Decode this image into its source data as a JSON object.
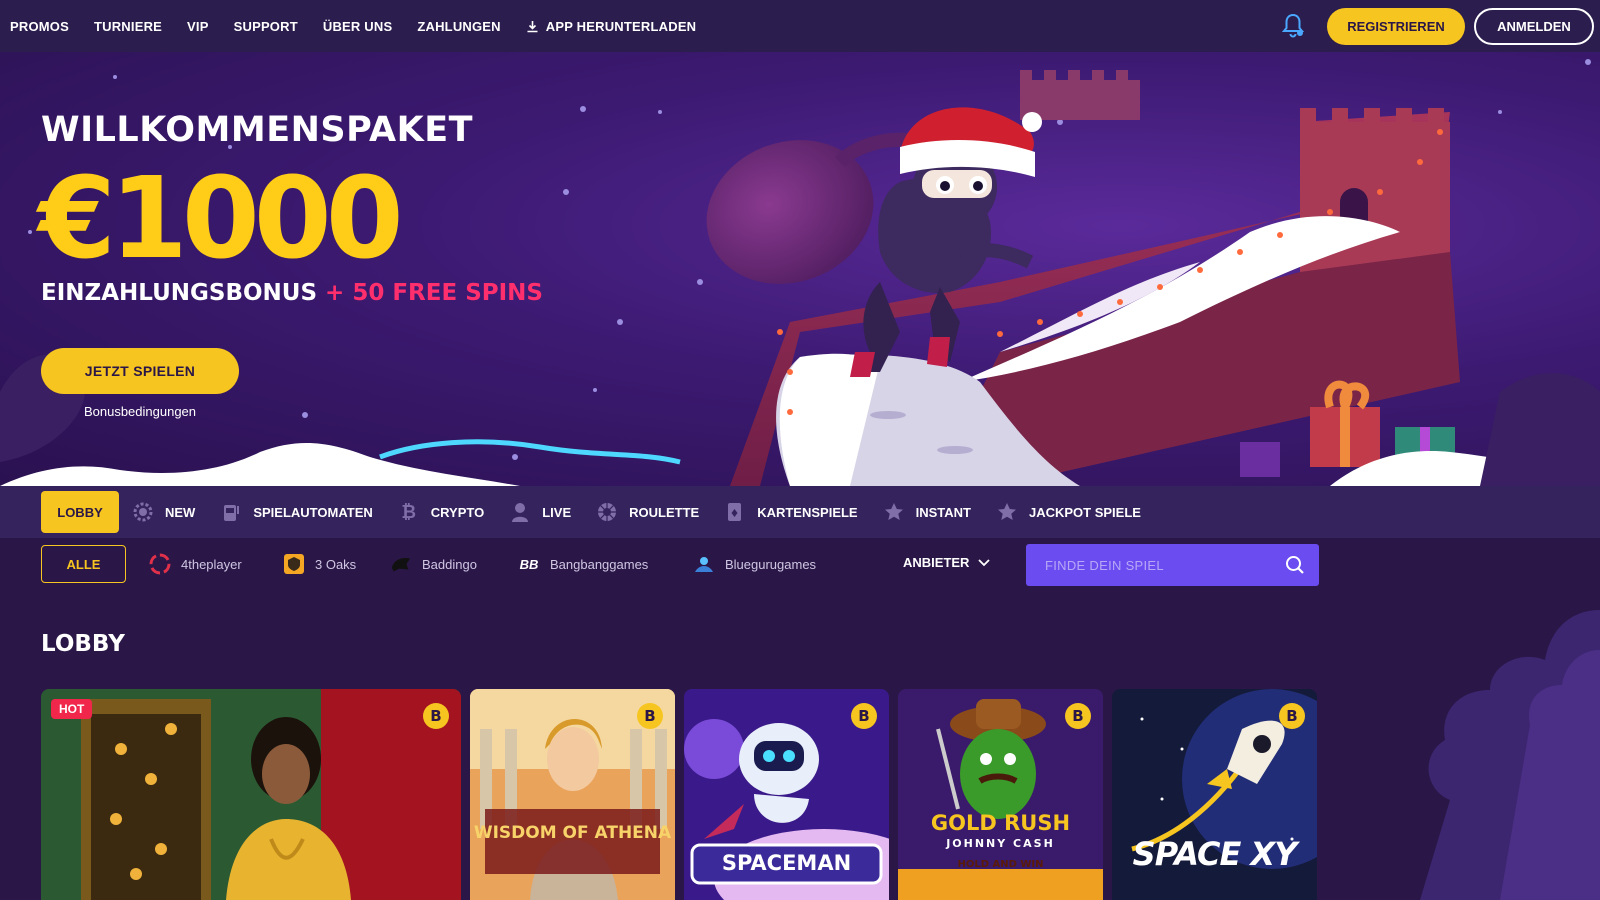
{
  "nav": {
    "links": [
      "PROMOS",
      "TURNIERE",
      "VIP",
      "SUPPORT",
      "ÜBER UNS",
      "ZAHLUNGEN"
    ],
    "app_download": "APP HERUNTERLADEN",
    "register": "REGISTRIEREN",
    "login": "ANMELDEN"
  },
  "hero": {
    "title": "WILLKOMMENSPAKET",
    "amount": "€1000",
    "subtitle_white": "EINZAHLUNGSBONUS",
    "subtitle_pink": "+ 50 FREE SPINS",
    "cta": "JETZT SPIELEN",
    "terms": "Bonusbedingungen"
  },
  "categories": [
    {
      "label": "LOBBY",
      "icon": ""
    },
    {
      "label": "NEW",
      "icon": "gear-badge-icon"
    },
    {
      "label": "SPIELAUTOMATEN",
      "icon": "slot-machine-icon"
    },
    {
      "label": "CRYPTO",
      "icon": "bitcoin-icon"
    },
    {
      "label": "LIVE",
      "icon": "dealer-icon"
    },
    {
      "label": "ROULETTE",
      "icon": "roulette-icon"
    },
    {
      "label": "KARTENSPIELE",
      "icon": "cards-icon"
    },
    {
      "label": "INSTANT",
      "icon": "star-icon"
    },
    {
      "label": "JACKPOT SPIELE",
      "icon": "star-icon"
    }
  ],
  "providers": {
    "all": "ALLE",
    "items": [
      "4theplayer",
      "3 Oaks",
      "Baddingo",
      "Bangbanggames",
      "Bluegurugames"
    ],
    "filter_label": "ANBIETER"
  },
  "search": {
    "placeholder": "FINDE DEIN SPIEL"
  },
  "lobby": {
    "title": "LOBBY",
    "hot_badge": "HOT",
    "crypto_badge": "B",
    "games": [
      {
        "title": ""
      },
      {
        "title": "WISDOM OF ATHENA"
      },
      {
        "title": "SPACEMAN"
      },
      {
        "title": "GOLD RUSH",
        "subtitle": "JOHNNY CASH",
        "tag": "HOLD AND WIN"
      },
      {
        "title": "SPACE XY"
      }
    ]
  },
  "colors": {
    "background": "#2a1747",
    "accent": "#f7c51f",
    "pink": "#ff2f6d",
    "search": "#6a4cf0"
  }
}
